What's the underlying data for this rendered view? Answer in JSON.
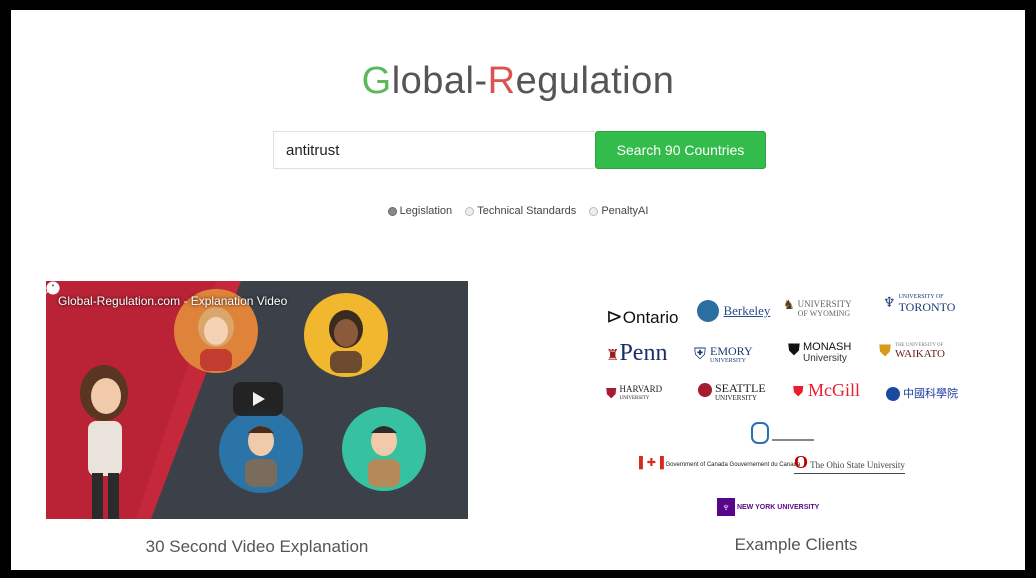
{
  "logo": {
    "first_letter": "G",
    "part1": "lobal-",
    "second_letter": "R",
    "part2": "egulation"
  },
  "search": {
    "value": "antitrust",
    "button_label": "Search 90 Countries"
  },
  "search_type": {
    "options": [
      {
        "label": "Legislation",
        "selected": true
      },
      {
        "label": "Technical Standards",
        "selected": false
      },
      {
        "label": "PenaltyAI",
        "selected": false
      }
    ]
  },
  "video": {
    "title": "Global-Regulation.com - Explanation Video",
    "caption": "30 Second Video Explanation"
  },
  "clients": {
    "caption": "Example Clients",
    "ontario": "Ontario",
    "berkeley": "Berkeley",
    "wyoming_top": "UNIVERSITY",
    "wyoming_bottom": "OF WYOMING",
    "toronto_top": "UNIVERSITY OF",
    "toronto": "TORONTO",
    "penn": "Penn",
    "emory": "EMORY",
    "emory_sub": "UNIVERSITY",
    "monash": "MONASH",
    "monash_sub": "University",
    "waikato_top": "THE UNIVERSITY OF",
    "waikato": "WAIKATO",
    "harvard": "HARVARD",
    "harvard_sub": "UNIVERSITY",
    "seattle": "SEATTLE",
    "seattle_sub": "UNIVERSITY",
    "mcgill": "McGill",
    "chinese": "中國科學院",
    "canada_gov1": "Government of Canada",
    "canada_gov2": "Gouvernement du Canada",
    "ohio_state": "The Ohio State University",
    "nyu": "NEW YORK UNIVERSITY"
  },
  "colors": {
    "green": "#33bb4c",
    "red": "#d9534f",
    "logo_gray": "#555555"
  }
}
